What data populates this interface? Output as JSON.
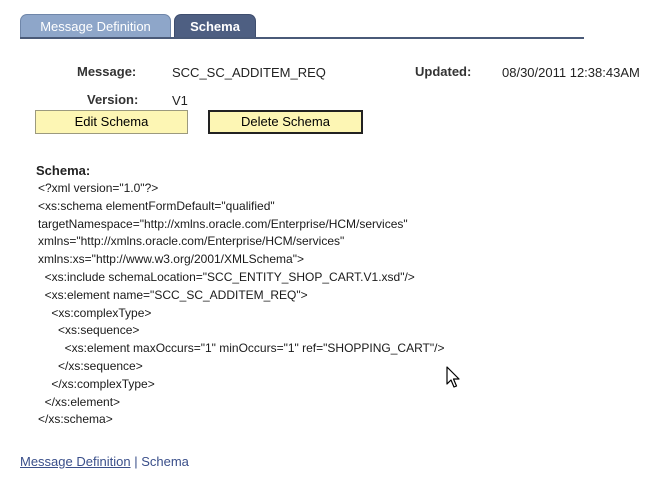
{
  "tabs": [
    {
      "label": "Message Definition",
      "active": false
    },
    {
      "label": "Schema",
      "active": true
    }
  ],
  "header": {
    "message_label": "Message:",
    "message_value": "SCC_SC_ADDITEM_REQ",
    "updated_label": "Updated:",
    "updated_value": "08/30/2011 12:38:43AM",
    "version_label": "Version:",
    "version_value": "V1"
  },
  "buttons": {
    "edit_label": "Edit Schema",
    "delete_label": "Delete Schema"
  },
  "schema": {
    "label": "Schema:",
    "lines": [
      "<?xml version=\"1.0\"?>",
      "<xs:schema elementFormDefault=\"qualified\"",
      "targetNamespace=\"http://xmlns.oracle.com/Enterprise/HCM/services\"",
      "xmlns=\"http://xmlns.oracle.com/Enterprise/HCM/services\"",
      "xmlns:xs=\"http://www.w3.org/2001/XMLSchema\">",
      "  <xs:include schemaLocation=\"SCC_ENTITY_SHOP_CART.V1.xsd\"/>",
      "  <xs:element name=\"SCC_SC_ADDITEM_REQ\">",
      "    <xs:complexType>",
      "      <xs:sequence>",
      "        <xs:element maxOccurs=\"1\" minOccurs=\"1\" ref=\"SHOPPING_CART\"/>",
      "      </xs:sequence>",
      "    </xs:complexType>",
      "  </xs:element>",
      "</xs:schema>"
    ]
  },
  "footer": {
    "link_label": "Message Definition",
    "separator": "|",
    "current_label": "Schema"
  },
  "colors": {
    "tab_inactive": "#8ea6c9",
    "tab_active": "#4e5f82",
    "button_bg": "#fdf6b4",
    "link": "#3a4f8a"
  },
  "icons": {
    "cursor": "mouse-pointer-icon"
  }
}
